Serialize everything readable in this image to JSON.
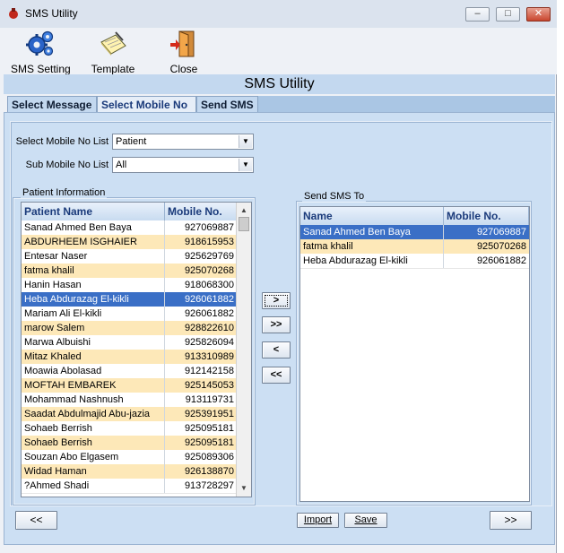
{
  "window": {
    "title": "SMS Utility"
  },
  "toolbar": {
    "sms_setting": "SMS Setting",
    "template": "Template",
    "close": "Close"
  },
  "banner": {
    "title": "SMS Utility"
  },
  "tabs": [
    {
      "label": "Select Message",
      "active": false
    },
    {
      "label": "Select Mobile No",
      "active": true
    },
    {
      "label": "Send SMS",
      "active": false
    }
  ],
  "filters": {
    "mobile_list_label": "Select Mobile No List",
    "mobile_list_value": "Patient",
    "sub_list_label": "Sub Mobile No List",
    "sub_list_value": "All"
  },
  "patient_info": {
    "title": "Patient Information",
    "col_name": "Patient Name",
    "col_mobile": "Mobile No.",
    "rows": [
      {
        "name": "Sanad Ahmed  Ben Baya",
        "mobile": "927069887"
      },
      {
        "name": "ABDURHEEM ISGHAIER",
        "mobile": "918615953"
      },
      {
        "name": "Entesar Naser",
        "mobile": "925629769"
      },
      {
        "name": "fatma khalil",
        "mobile": "925070268"
      },
      {
        "name": "Hanin Hasan",
        "mobile": "918068300"
      },
      {
        "name": "Heba Abdurazag  El-kikli",
        "mobile": "926061882"
      },
      {
        "name": "Mariam Ali   El-kikli",
        "mobile": "926061882"
      },
      {
        "name": "marow Salem",
        "mobile": "928822610"
      },
      {
        "name": "Marwa Albuishi",
        "mobile": "925826094"
      },
      {
        "name": "Mitaz  Khaled",
        "mobile": "913310989"
      },
      {
        "name": "Moawia Abolasad",
        "mobile": "912142158"
      },
      {
        "name": "MOFTAH EMBAREK",
        "mobile": "925145053"
      },
      {
        "name": "Mohammad Nashnush",
        "mobile": "913119731"
      },
      {
        "name": "Saadat Abdulmajid  Abu-jazia",
        "mobile": "925391951"
      },
      {
        "name": "Sohaeb Berrish",
        "mobile": "925095181"
      },
      {
        "name": "Sohaeb Berrish",
        "mobile": "925095181"
      },
      {
        "name": "Souzan Abo Elgasem",
        "mobile": "925089306"
      },
      {
        "name": "Widad Haman",
        "mobile": "926138870"
      },
      {
        "name": "?Ahmed Shadi",
        "mobile": "913728297"
      }
    ],
    "selected_index": 5
  },
  "move_buttons": {
    "add_one": ">",
    "add_all": ">>",
    "remove_one": "<",
    "remove_all": "<<"
  },
  "send_to": {
    "title": "Send SMS To",
    "col_name": "Name",
    "col_mobile": "Mobile No.",
    "rows": [
      {
        "name": "Sanad Ahmed  Ben Baya",
        "mobile": "927069887"
      },
      {
        "name": "fatma khalil",
        "mobile": "925070268"
      },
      {
        "name": "Heba Abdurazag  El-kikli",
        "mobile": "926061882"
      }
    ],
    "selected_index": 0
  },
  "footer": {
    "back": "<<",
    "import": "Import",
    "save": "Save",
    "next": ">>"
  }
}
